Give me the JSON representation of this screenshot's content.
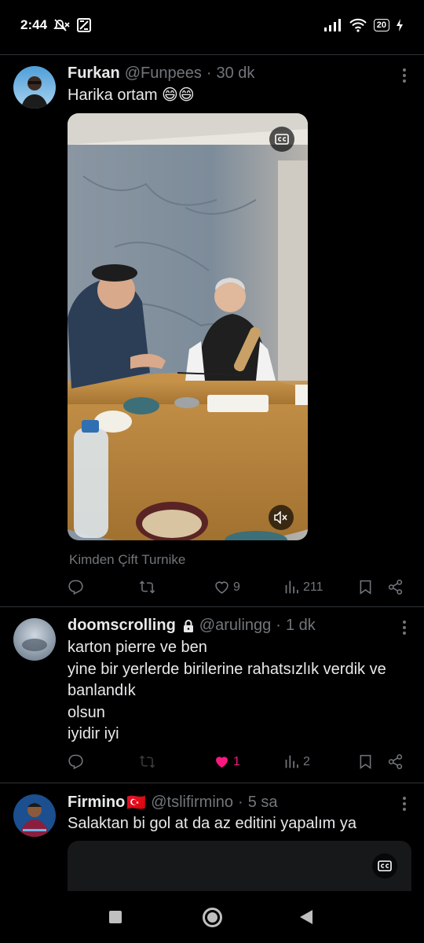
{
  "status": {
    "time": "2:44",
    "battery": "20"
  },
  "tweets": [
    {
      "name": "Furkan",
      "handle": "@Funpees",
      "sep": "·",
      "time": "30 dk",
      "text": "Harika ortam 😄😄",
      "source": "Kimden Çift Turnike",
      "likes": "9",
      "views": "211"
    },
    {
      "name": "doomscrolling",
      "handle": "@arulingg",
      "sep": "·",
      "time": "1 dk",
      "lines": [
        "karton pierre ve ben",
        "yine bir yerlerde birilerine rahatsızlık verdik ve",
        "banlandık",
        "olsun",
        "iyidir iyi"
      ],
      "likes": "1",
      "views": "2"
    },
    {
      "name": "Firmino",
      "flag": "🇹🇷",
      "handle": "@tslifirmino",
      "sep": "·",
      "time": "5 sa",
      "text": "Salaktan bi gol at da az editini yapalım ya"
    }
  ],
  "icons": {
    "reply": "reply-icon",
    "retweet": "retweet-icon",
    "like": "like-icon",
    "views": "views-icon",
    "bookmark": "bookmark-icon",
    "share": "share-icon",
    "more": "more-icon",
    "cc": "closed-captions-icon",
    "mute": "mute-icon",
    "lock": "lock-icon"
  },
  "colors": {
    "like_active": "#f91880",
    "muted": "#71767b",
    "text": "#e7e9ea",
    "divider": "#2f3336"
  }
}
